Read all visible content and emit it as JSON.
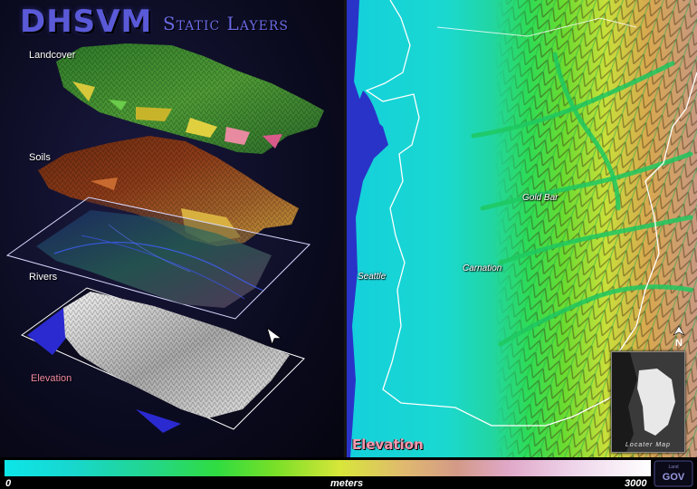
{
  "header": {
    "title": "DHSVM",
    "subtitle": "Static Layers"
  },
  "layers": [
    {
      "label": "Landcover"
    },
    {
      "label": "Soils"
    },
    {
      "label": "Rivers"
    },
    {
      "label": "Elevation"
    }
  ],
  "map": {
    "title": "Elevation",
    "places": [
      "Seattle",
      "Carnation",
      "Gold Bar"
    ],
    "north_arrow": "N",
    "locator_label": "Locater Map"
  },
  "legend": {
    "min": "0",
    "unit": "meters",
    "max": "3000"
  },
  "logo": {
    "text": "GOV",
    "small_text": "Land"
  },
  "colors": {
    "title": "#5a5ad8",
    "water": "#2a33c8",
    "lowland": "#1ad6e0",
    "foothill": "#2fdc45",
    "upland": "#d8e040",
    "highland": "#c88a50",
    "boundary": "#ffffff",
    "elevation_label": "#f59ab0"
  }
}
